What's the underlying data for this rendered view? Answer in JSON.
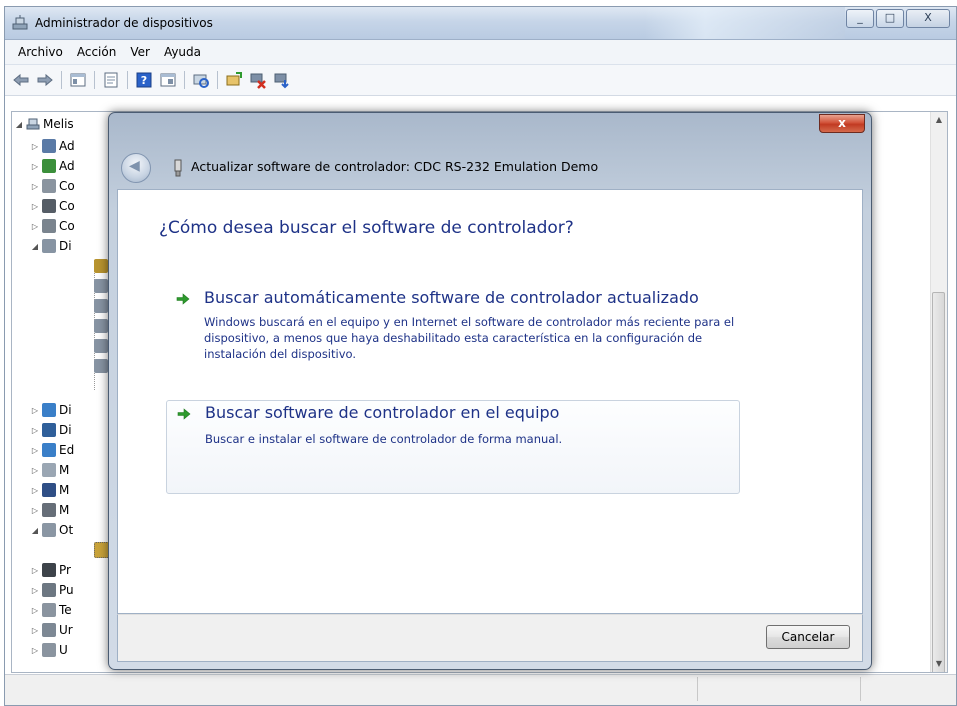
{
  "window": {
    "title": "Administrador de dispositivos",
    "controls": {
      "minimize_glyph": "_",
      "maximize_glyph": "□",
      "close_glyph": "X"
    }
  },
  "menubar": {
    "items": [
      "Archivo",
      "Acción",
      "Ver",
      "Ayuda"
    ]
  },
  "toolbar": {
    "buttons": [
      "back-icon",
      "forward-icon",
      "console-tree-icon",
      "properties-icon",
      "help-icon",
      "view-icon",
      "scan-hardware-icon",
      "update-driver-icon",
      "disable-device-icon",
      "uninstall-device-icon"
    ]
  },
  "tree": {
    "root_label": "Melis",
    "rows": [
      "Ad",
      "Ad",
      "Co",
      "Co",
      "Co",
      "Di",
      "",
      "",
      "",
      "",
      "",
      "Di",
      "Di",
      "Ed",
      "M",
      "M",
      "M",
      "Ot",
      "",
      "Pr",
      "Pu",
      "Te",
      "Ur",
      "U"
    ]
  },
  "dialog": {
    "title": "Actualizar software de controlador: CDC RS-232 Emulation Demo",
    "close_glyph": "x",
    "heading": "¿Cómo desea buscar el software de controlador?",
    "options": [
      {
        "title": "Buscar automáticamente software de controlador actualizado",
        "description": "Windows buscará en el equipo y en Internet el software de controlador más reciente para el dispositivo, a menos que haya deshabilitado esta característica en la configuración de instalación del dispositivo."
      },
      {
        "title": "Buscar software de controlador en el equipo",
        "description": "Buscar e instalar el software de controlador de forma manual."
      }
    ],
    "cancel_label": "Cancelar"
  },
  "colors": {
    "link_blue": "#1e3287",
    "option_arrow_green": "#2e9a2e",
    "close_red": "#c13a22"
  }
}
